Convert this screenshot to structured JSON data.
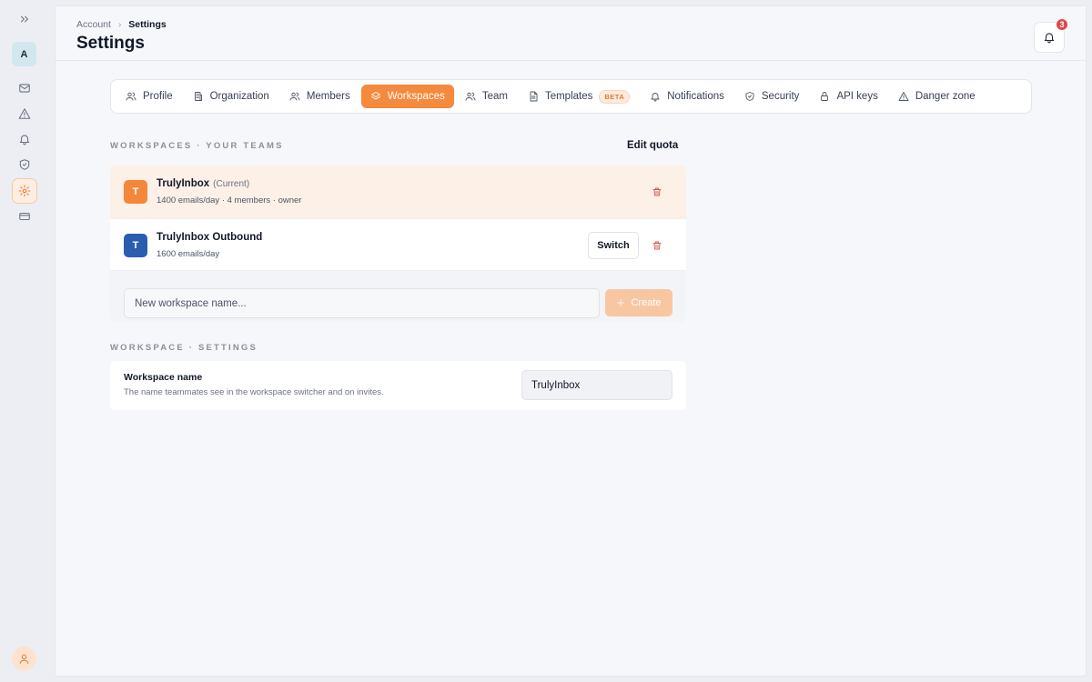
{
  "rail": {
    "avatar_initial": "A",
    "items": [
      {
        "icon": "chevrons-right-icon"
      },
      {
        "icon": "mail-icon"
      },
      {
        "icon": "alert-triangle-icon"
      },
      {
        "icon": "bell-icon"
      },
      {
        "icon": "shield-check-icon"
      },
      {
        "icon": "gear-icon",
        "active": true
      },
      {
        "icon": "credit-card-icon"
      }
    ],
    "user_icon": "user-icon"
  },
  "header": {
    "breadcrumb": [
      "Account",
      "Settings"
    ],
    "title": "Settings",
    "notifications_count": "3"
  },
  "tabs": [
    {
      "label": "Profile",
      "icon": "users-icon"
    },
    {
      "label": "Organization",
      "icon": "building-icon"
    },
    {
      "label": "Members",
      "icon": "users-icon"
    },
    {
      "label": "Workspaces",
      "icon": "layers-icon",
      "active": true
    },
    {
      "label": "Team",
      "icon": "users-icon"
    },
    {
      "label": "Templates",
      "icon": "file-text-icon",
      "badge": "BETA"
    },
    {
      "label": "Notifications",
      "icon": "bell-icon"
    },
    {
      "label": "Security",
      "icon": "shield-check-icon"
    },
    {
      "label": "API keys",
      "icon": "lock-icon"
    },
    {
      "label": "Danger zone",
      "icon": "alert-triangle-icon"
    }
  ],
  "workspaces_section": {
    "label": "WORKSPACES · YOUR TEAMS",
    "edit_quota": "Edit quota",
    "items": [
      {
        "initial": "T",
        "name": "TrulyInbox",
        "tag": "(Current)",
        "meta": "1400 emails/day · 4 members · owner",
        "color": "#f5873a"
      },
      {
        "initial": "T",
        "name": "TrulyInbox Outbound",
        "meta": "1600 emails/day",
        "color": "#2a5db0",
        "action": "Switch"
      }
    ],
    "new_placeholder": "New workspace name...",
    "create_label": "Create"
  },
  "settings_section": {
    "label": "WORKSPACE · SETTINGS",
    "name_label": "Workspace name",
    "name_help": "The name teammates see in the workspace switcher and on invites.",
    "name_value": "TrulyInbox"
  },
  "colors": {
    "accent": "#f38a3c",
    "danger": "#d9534f",
    "current_row_bg": "#fdf0e7"
  }
}
